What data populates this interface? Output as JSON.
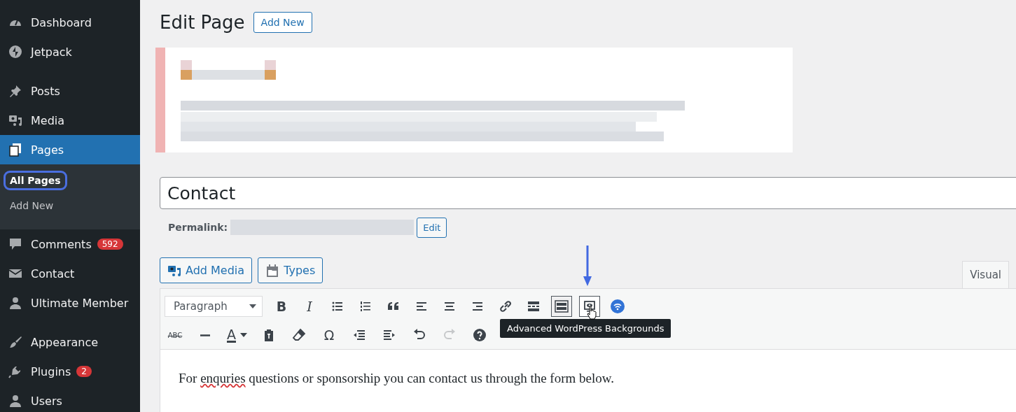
{
  "sidebar": {
    "items": [
      {
        "label": "Dashboard",
        "selected": false
      },
      {
        "label": "Jetpack",
        "selected": false
      },
      {
        "label": "Posts",
        "selected": false
      },
      {
        "label": "Media",
        "selected": false
      },
      {
        "label": "Pages",
        "selected": true,
        "children": [
          {
            "label": "All Pages",
            "selected": true,
            "circled": true
          },
          {
            "label": "Add New",
            "selected": false,
            "circled": false
          }
        ]
      },
      {
        "label": "Comments",
        "selected": false,
        "badge": "592"
      },
      {
        "label": "Contact",
        "selected": false
      },
      {
        "label": "Ultimate Member",
        "selected": false
      },
      {
        "label": "Appearance",
        "selected": false
      },
      {
        "label": "Plugins",
        "selected": false,
        "badge": "2"
      },
      {
        "label": "Users",
        "selected": false
      }
    ]
  },
  "header": {
    "title": "Edit Page",
    "button": "Add New"
  },
  "notice": {
    "kind": "picture"
  },
  "title_field": {
    "value": "Contact"
  },
  "permalink": {
    "label": "Permalink:",
    "button": "Edit"
  },
  "media_buttons": [
    "Add Media",
    "Types"
  ],
  "editor_tabs": [
    {
      "label": "Visual",
      "selected": true
    }
  ],
  "toolbar": {
    "format_select": {
      "value": "Paragraph"
    },
    "row_1": [
      {
        "kind": "glyph",
        "label": "B",
        "pressed": false,
        "hovered": false,
        "disabled": false
      },
      {
        "kind": "glyph",
        "label": "I",
        "pressed": false,
        "hovered": false,
        "disabled": false
      },
      {
        "kind": "icon",
        "pressed": false,
        "hovered": false,
        "disabled": false
      },
      {
        "kind": "icon",
        "pressed": false,
        "hovered": false,
        "disabled": false
      },
      {
        "kind": "icon",
        "pressed": false,
        "hovered": false,
        "disabled": false
      },
      {
        "kind": "icon",
        "pressed": false,
        "hovered": false,
        "disabled": false
      },
      {
        "kind": "icon",
        "pressed": false,
        "hovered": false,
        "disabled": false
      },
      {
        "kind": "icon",
        "pressed": false,
        "hovered": false,
        "disabled": false
      },
      {
        "kind": "icon",
        "pressed": false,
        "hovered": false,
        "disabled": false
      },
      {
        "kind": "icon",
        "pressed": false,
        "hovered": false,
        "disabled": false
      },
      {
        "kind": "icon",
        "pressed": true,
        "hovered": false,
        "disabled": false
      },
      {
        "kind": "icon",
        "pressed": false,
        "hovered": true,
        "disabled": false
      },
      {
        "kind": "icon",
        "pressed": false,
        "hovered": false,
        "disabled": false
      }
    ],
    "row_2": [
      {
        "kind": "glyph",
        "label": "ABC",
        "pressed": false,
        "hovered": false,
        "disabled": false
      },
      {
        "kind": "icon",
        "pressed": false,
        "hovered": false,
        "disabled": false
      },
      {
        "kind": "color",
        "label": "A",
        "pressed": false,
        "hovered": false,
        "disabled": false
      },
      {
        "kind": "icon",
        "pressed": false,
        "hovered": false,
        "disabled": false
      },
      {
        "kind": "icon",
        "pressed": false,
        "hovered": false,
        "disabled": false
      },
      {
        "kind": "glyph",
        "label": "Ω",
        "pressed": false,
        "hovered": false,
        "disabled": false
      },
      {
        "kind": "icon",
        "pressed": false,
        "hovered": false,
        "disabled": false
      },
      {
        "kind": "icon",
        "pressed": false,
        "hovered": false,
        "disabled": false
      },
      {
        "kind": "icon",
        "pressed": false,
        "hovered": false,
        "disabled": false
      },
      {
        "kind": "icon",
        "pressed": false,
        "hovered": false,
        "disabled": true
      },
      {
        "kind": "icon",
        "pressed": false,
        "hovered": false,
        "disabled": false
      }
    ]
  },
  "tooltip": "Advanced WordPress Backgrounds",
  "content": [
    {
      "text": "For ",
      "misspelled": false
    },
    {
      "text": "enquries",
      "misspelled": true
    },
    {
      "text": " questions or sponsorship you can contact us through the form below.",
      "misspelled": false
    }
  ]
}
